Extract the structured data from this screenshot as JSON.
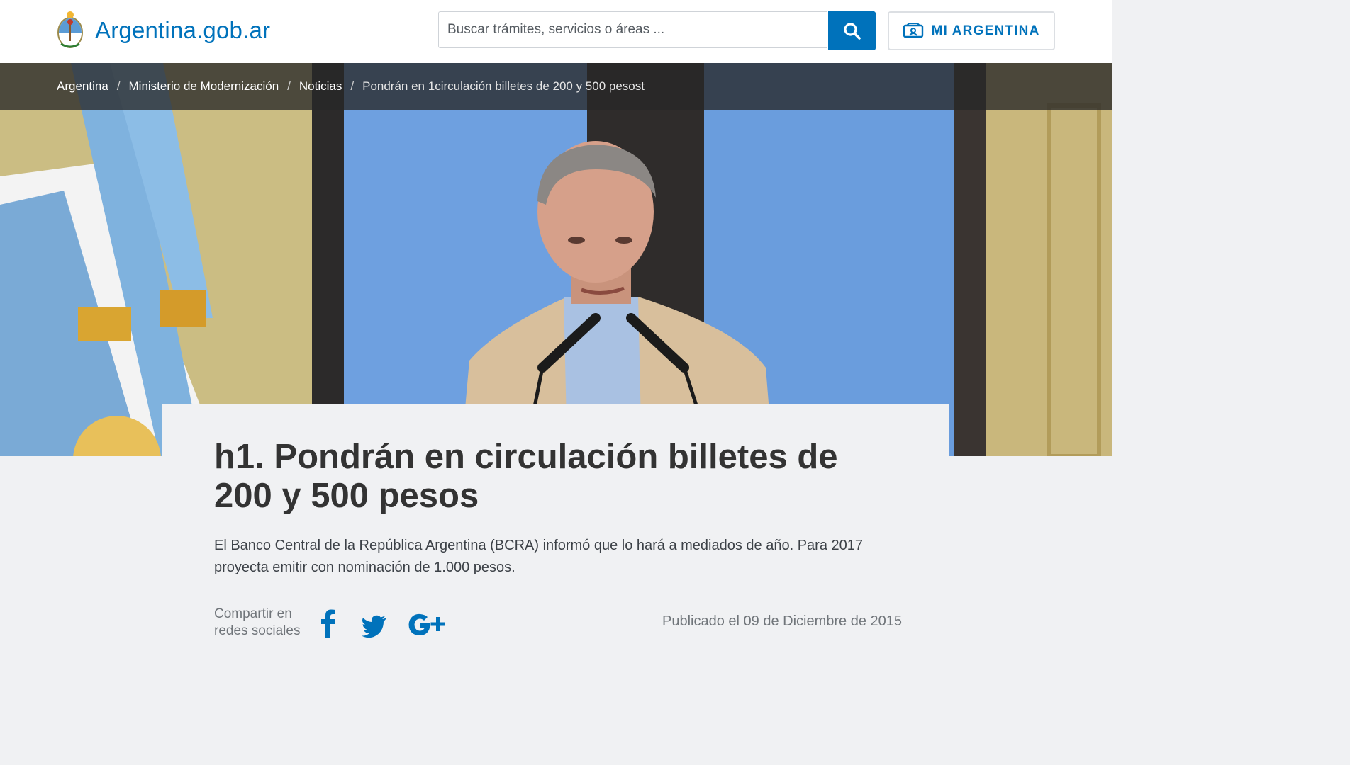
{
  "header": {
    "site_name": "Argentina.gob.ar",
    "search": {
      "placeholder": "Buscar trámites, servicios o áreas ...",
      "value": ""
    },
    "mi_argentina_label": "MI ARGENTINA",
    "accent_color": "#0072bb"
  },
  "breadcrumb": [
    {
      "label": "Argentina"
    },
    {
      "label": "Ministerio de Modernización"
    },
    {
      "label": "Noticias"
    },
    {
      "label": "Pondrán en 1circulación billetes de 200 y 500 pesost"
    }
  ],
  "breadcrumb_separator": "/",
  "article": {
    "title": "h1. Pondrán en circulación billetes de 200 y 500 pesos",
    "lead": "El Banco Central de la República Argentina (BCRA) informó que lo hará a mediados de año. Para 2017 proyecta emitir con nominación de 1.000 pesos.",
    "share_label": "Compartir en redes sociales",
    "social": [
      {
        "name": "facebook",
        "icon": "facebook-icon"
      },
      {
        "name": "twitter",
        "icon": "twitter-icon"
      },
      {
        "name": "google-plus",
        "icon": "google-plus-icon"
      }
    ],
    "published": "Publicado el 09 de Diciembre de 2015"
  },
  "icons": {
    "logo": "argentina-coat-of-arms-icon",
    "search": "search-icon",
    "mi_argentina": "id-card-icon"
  }
}
